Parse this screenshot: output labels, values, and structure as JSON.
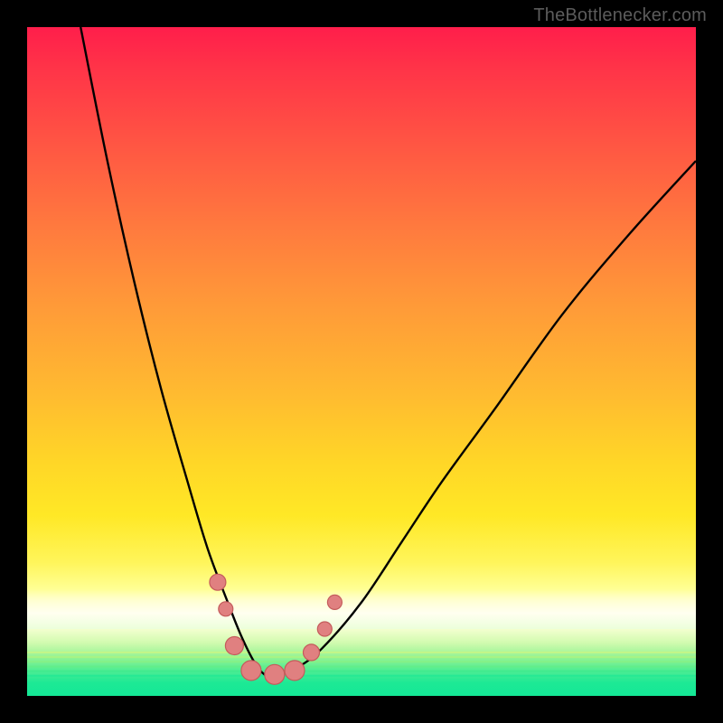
{
  "watermark": "TheBottlenecker.com",
  "colors": {
    "frame": "#000000",
    "top": "#ff1f4a",
    "mid": "#ffcd22",
    "paleYellow": "#ffff9b",
    "good": "#18e994",
    "curve": "#000000",
    "marker_fill": "#e08080",
    "marker_stroke": "#c45b5b",
    "watermark": "#5c5c5c"
  },
  "chart_data": {
    "type": "line",
    "title": "",
    "xlabel": "",
    "ylabel": "",
    "xlim": [
      0,
      100
    ],
    "ylim": [
      0,
      100
    ],
    "series": [
      {
        "name": "bottleneck-curve",
        "x": [
          8,
          12,
          16,
          20,
          24,
          27,
          30,
          32,
          34,
          35.5,
          37,
          40,
          44,
          50,
          56,
          62,
          70,
          80,
          90,
          100
        ],
        "y": [
          100,
          80,
          62,
          46,
          32,
          22,
          14,
          9,
          5,
          3.2,
          3,
          4,
          7,
          14,
          23,
          32,
          43,
          57,
          69,
          80
        ]
      }
    ],
    "markers": [
      {
        "x": 28.5,
        "y": 17,
        "r": 9
      },
      {
        "x": 29.7,
        "y": 13,
        "r": 8
      },
      {
        "x": 31.0,
        "y": 7.5,
        "r": 10
      },
      {
        "x": 33.5,
        "y": 3.8,
        "r": 11
      },
      {
        "x": 37.0,
        "y": 3.2,
        "r": 11
      },
      {
        "x": 40.0,
        "y": 3.8,
        "r": 11
      },
      {
        "x": 42.5,
        "y": 6.5,
        "r": 9
      },
      {
        "x": 44.5,
        "y": 10.0,
        "r": 8
      },
      {
        "x": 46.0,
        "y": 14.0,
        "r": 8
      }
    ],
    "bottom_lines": [
      {
        "y1": 3.0,
        "y2": 3.0,
        "color": "#18e994"
      },
      {
        "y1": 3.7,
        "y2": 3.7,
        "color": "#39eb8b"
      },
      {
        "y1": 4.4,
        "y2": 4.4,
        "color": "#63ee83"
      },
      {
        "y1": 5.1,
        "y2": 5.1,
        "color": "#8cf17c"
      },
      {
        "y1": 5.8,
        "y2": 5.8,
        "color": "#b7f477"
      },
      {
        "y1": 6.5,
        "y2": 6.5,
        "color": "#dbf777"
      }
    ]
  }
}
